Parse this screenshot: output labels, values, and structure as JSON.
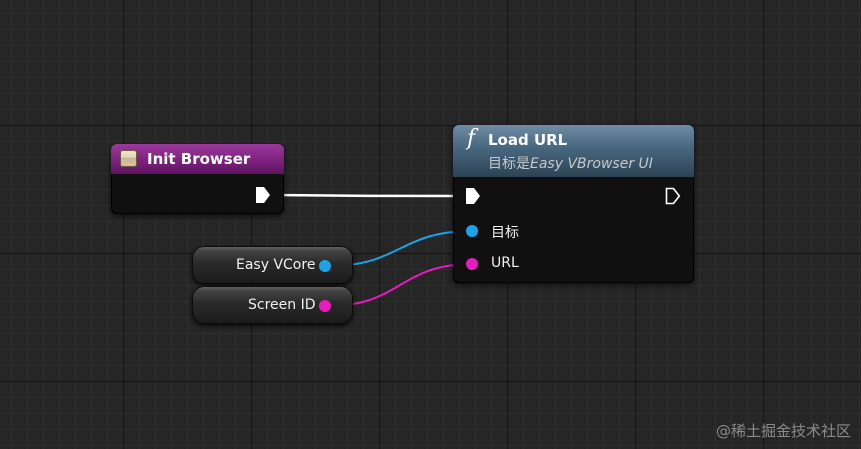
{
  "nodes": {
    "init_browser": {
      "title": "Init Browser"
    },
    "load_url": {
      "title": "Load URL",
      "function_symbol": "f",
      "target_prefix": "目标是",
      "target_class": "Easy VBrowser UI",
      "pins": {
        "target_label": "目标",
        "url_label": "URL"
      }
    },
    "easy_vcore": {
      "label": "Easy VCore"
    },
    "screen_id": {
      "label": "Screen ID"
    }
  },
  "colors": {
    "object_pin": "#1aa3e8",
    "string_pin": "#e81ac0",
    "exec_wire": "#ffffff",
    "init_header": "#8a2a8c",
    "load_header": "#4f6f85"
  },
  "icons": {
    "event_icon": "event-box-icon",
    "exec": "exec-arrow-icon"
  },
  "watermark": "@稀土掘金技术社区"
}
